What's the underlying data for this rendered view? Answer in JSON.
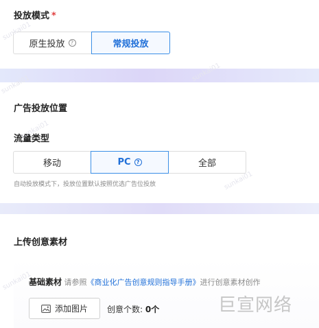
{
  "delivery_mode": {
    "title": "投放模式",
    "required_mark": "*",
    "options": [
      {
        "label": "原生投放",
        "help_icon": "?"
      },
      {
        "label": "常规投放"
      }
    ],
    "selected": "常规投放"
  },
  "placement": {
    "title": "广告投放位置",
    "traffic_type": {
      "title": "流量类型",
      "options": [
        {
          "label": "移动"
        },
        {
          "label": "PC",
          "help_icon": "?"
        },
        {
          "label": "全部"
        }
      ],
      "selected": "PC"
    },
    "hint": "自动投放模式下，投放位置默认按照优选广告位投放"
  },
  "upload": {
    "title": "上传创意素材",
    "basic_label": "基础素材",
    "refer_text": "请参照",
    "guide_link": "《商业化广告创意规则指导手册》",
    "after_text": "进行创意素材创作",
    "add_image_label": "添加图片",
    "count_label": "创意个数:",
    "count_value": "0个"
  },
  "watermark": {
    "brand": "巨宣网络",
    "user": "sunkai01"
  },
  "colors": {
    "accent": "#1f6fd8",
    "required": "#e04040",
    "band_purple": "#dcd6f8"
  }
}
